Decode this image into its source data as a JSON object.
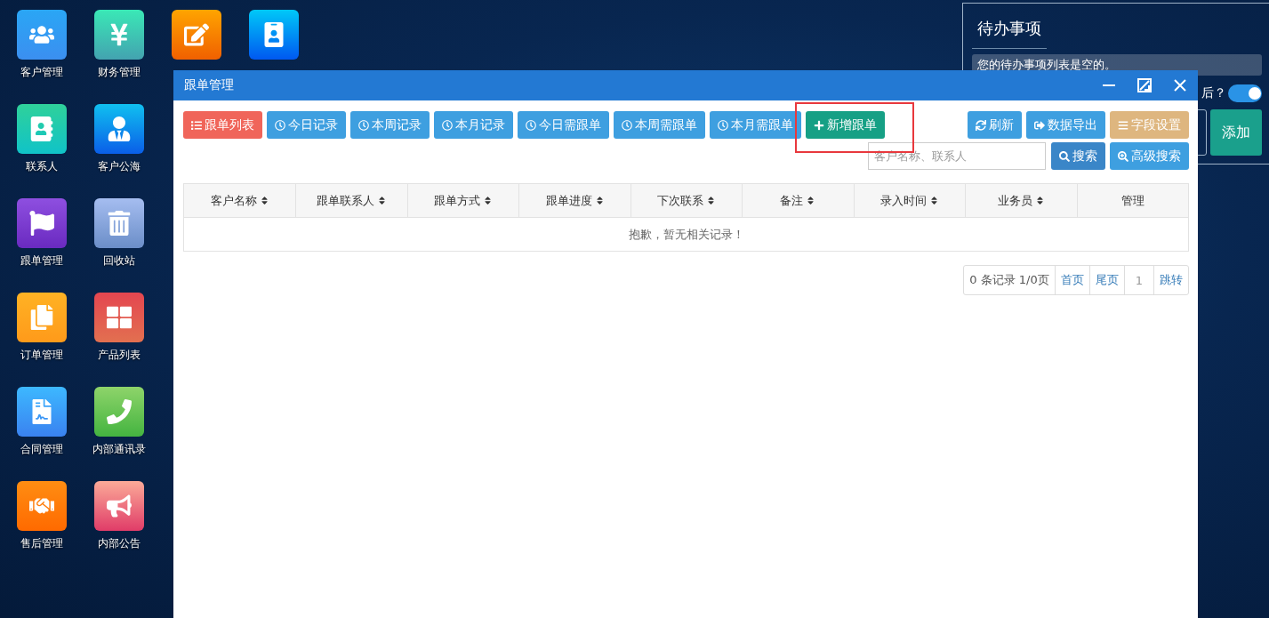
{
  "desktop_columns": [
    {
      "icons": [
        {
          "label": "客户管理",
          "kind": "customers"
        },
        {
          "label": "联系人",
          "kind": "contacts"
        },
        {
          "label": "跟单管理",
          "kind": "follow"
        },
        {
          "label": "订单管理",
          "kind": "orders"
        },
        {
          "label": "合同管理",
          "kind": "contracts"
        },
        {
          "label": "售后管理",
          "kind": "aftersale"
        }
      ]
    },
    {
      "icons": [
        {
          "label": "财务管理",
          "kind": "finance"
        },
        {
          "label": "客户公海",
          "kind": "pool"
        },
        {
          "label": "回收站",
          "kind": "trash"
        },
        {
          "label": "产品列表",
          "kind": "products"
        },
        {
          "label": "内部通讯录",
          "kind": "phonebook"
        },
        {
          "label": "内部公告",
          "kind": "notice"
        }
      ]
    },
    {
      "icons": [
        {
          "kind": "report"
        }
      ]
    },
    {
      "icons": [
        {
          "kind": "staff"
        }
      ]
    }
  ],
  "todo_panel": {
    "title": "待办事项",
    "empty_message": "您的待办事项列表是空的。",
    "toggle_label": "后？",
    "toggle_on": true,
    "add_button": "添加"
  },
  "window": {
    "title": "跟单管理",
    "toolbar_left": [
      {
        "label": "跟单列表",
        "kind": "list",
        "highlighted": false
      },
      {
        "label": "今日记录",
        "kind": "filter",
        "highlighted": false
      },
      {
        "label": "本周记录",
        "kind": "filter",
        "highlighted": false
      },
      {
        "label": "本月记录",
        "kind": "filter",
        "highlighted": false
      },
      {
        "label": "今日需跟单",
        "kind": "filter",
        "highlighted": false
      },
      {
        "label": "本周需跟单",
        "kind": "filter",
        "highlighted": false
      },
      {
        "label": "本月需跟单",
        "kind": "filter",
        "highlighted": false
      },
      {
        "label": "新增跟单",
        "kind": "create",
        "highlighted": true
      }
    ],
    "toolbar_right": [
      {
        "label": "刷新",
        "kind": "refresh",
        "highlighted": false
      },
      {
        "label": "数据导出",
        "kind": "export",
        "highlighted": false
      },
      {
        "label": "字段设置",
        "kind": "fields",
        "highlighted": false
      }
    ],
    "search": {
      "placeholder": "客户名称、联系人"
    },
    "search_buttons": [
      {
        "label": "搜索",
        "kind": "search",
        "highlighted": false
      },
      {
        "label": "高级搜索",
        "kind": "advanced",
        "highlighted": false
      }
    ],
    "table": {
      "columns": [
        {
          "label": "客户名称",
          "sortable": true
        },
        {
          "label": "跟单联系人",
          "sortable": true
        },
        {
          "label": "跟单方式",
          "sortable": true
        },
        {
          "label": "跟单进度",
          "sortable": true
        },
        {
          "label": "下次联系",
          "sortable": true
        },
        {
          "label": "备注",
          "sortable": true
        },
        {
          "label": "录入时间",
          "sortable": true
        },
        {
          "label": "业务员",
          "sortable": true
        },
        {
          "label": "管理",
          "sortable": false
        }
      ],
      "empty_message": "抱歉，暂无相关记录！"
    },
    "pagination": [
      {
        "label": "0 条记录 1/0页",
        "kind": "info"
      },
      {
        "label": "首页",
        "kind": "link"
      },
      {
        "label": "尾页",
        "kind": "link"
      },
      {
        "label": "1",
        "kind": "current"
      },
      {
        "label": "跳转",
        "kind": "link"
      }
    ]
  }
}
